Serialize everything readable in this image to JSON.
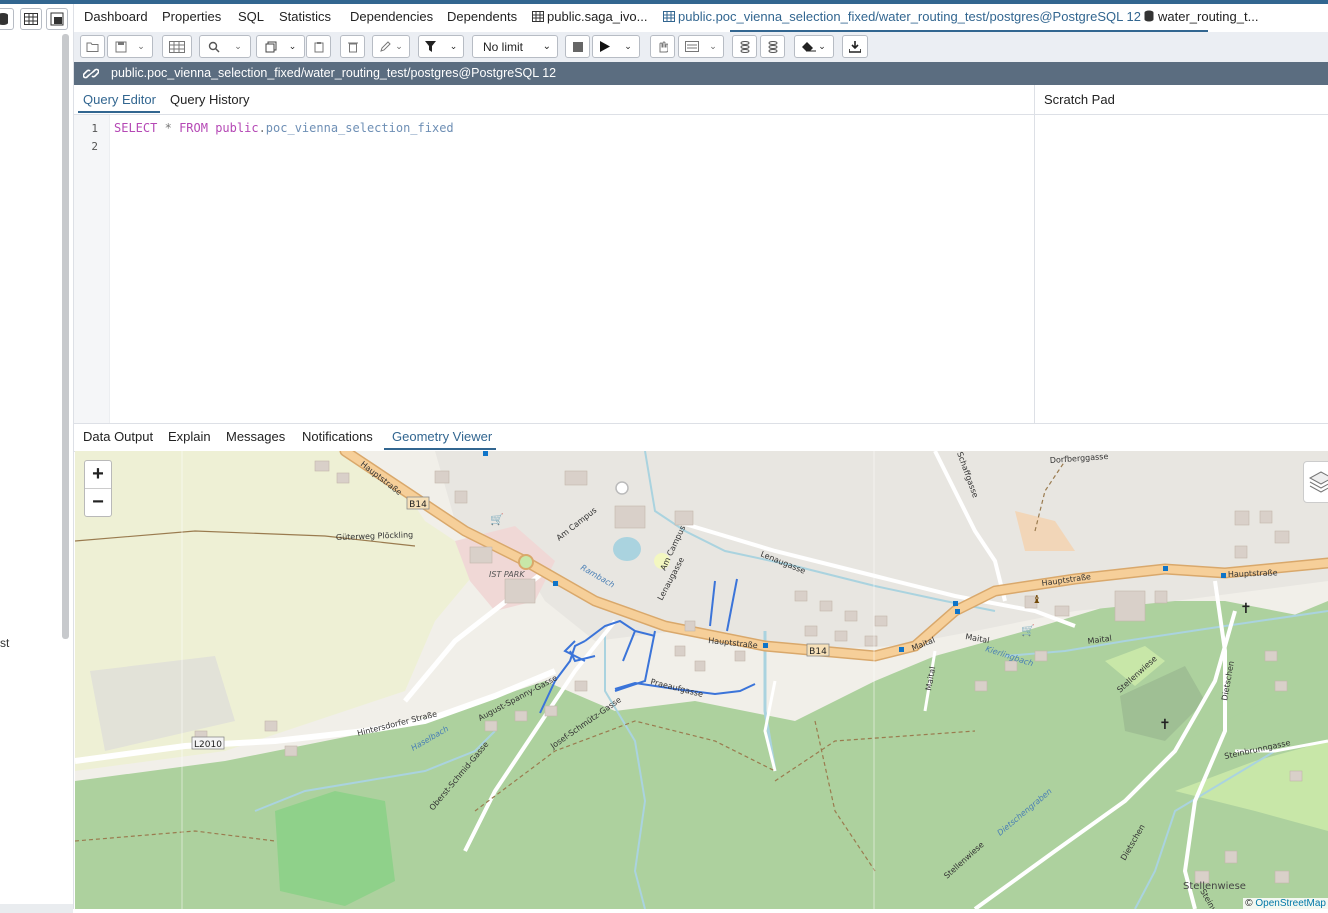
{
  "nav": {
    "tabs": [
      "Dashboard",
      "Properties",
      "SQL",
      "Statistics",
      "Dependencies",
      "Dependents",
      "public.saga_ivo...",
      "public.poc_vienna_selection_fixed/water_routing_test/postgres@PostgreSQL 12",
      "water_routing_t..."
    ],
    "active_index": 7
  },
  "toolbar": {
    "limit_label": "No limit"
  },
  "connection": {
    "label": "public.poc_vienna_selection_fixed/water_routing_test/postgres@PostgreSQL 12"
  },
  "editor": {
    "tabs": [
      "Query Editor",
      "Query History"
    ],
    "active_index": 0,
    "line_numbers": [
      "1",
      "2"
    ],
    "code": {
      "kw_select": "SELECT",
      "star": "*",
      "kw_from": "FROM",
      "schema": "public",
      "dot": ".",
      "table": "poc_vienna_selection_fixed"
    }
  },
  "scratch_pad": {
    "title": "Scratch Pad"
  },
  "results": {
    "tabs": [
      "Data Output",
      "Explain",
      "Messages",
      "Notifications",
      "Geometry Viewer"
    ],
    "active_index": 4
  },
  "left_panel": {
    "partial_text": "st"
  },
  "map": {
    "zoom_in": "+",
    "zoom_out": "−",
    "attribution_prefix": "©",
    "attribution_link": "OpenStreetMap",
    "labels": {
      "hauptstrasse_1": "Hauptstraße",
      "hauptstrasse_2": "Hauptstraße",
      "hauptstrasse_3": "Hauptstraße",
      "hauptstrasse_4": "Hauptstraße",
      "b14_a": "B14",
      "b14_b": "B14",
      "l2010": "L2010",
      "gueterweg": "Güterweg Plöckling",
      "ist_park": "IST PARK",
      "am_campus_1": "Am Campus",
      "am_campus_2": "Am Campus",
      "rambach": "Rambach",
      "lenaugasse_1": "Lenaugasse",
      "lenaugasse_2": "Lenaugasse",
      "hintersdorfer": "Hintersdorfer Straße",
      "haselbach": "Haselbach",
      "august_spanny": "August-Spanny-Gasse",
      "josef_schmuetz": "Josef-Schmütz-Gasse",
      "pracaufgasse": "Praeaufgasse",
      "oberst_schmid": "Oberst-Schmid-Gasse",
      "maital_1": "Maital",
      "maital_2": "Maital",
      "maital_3": "Maital",
      "maital_4": "Maital",
      "kierlingbach": "Kierlingbach",
      "schaffgasse": "Schaffgasse",
      "dorfberggasse": "Dorfberggasse",
      "stellenwiese_1": "Stellenwiese",
      "stellenwiese_2": "Stellenwiese",
      "stellenwiese_3": "Stellenwiese",
      "dietschen_1": "Dietschen",
      "dietschen_2": "Dietschen",
      "dietschengraben": "Dietschengraben",
      "steinbrunngasse": "Steinbrunngasse",
      "steinw": "Steinw..."
    }
  },
  "colors": {
    "accent": "#326690",
    "connection_bar": "#5b6d80",
    "primary_road": "#f6cf99",
    "forest": "#add19e",
    "farmland": "#eef0d5",
    "water": "#aad3df",
    "route_line": "#3b74d9"
  }
}
